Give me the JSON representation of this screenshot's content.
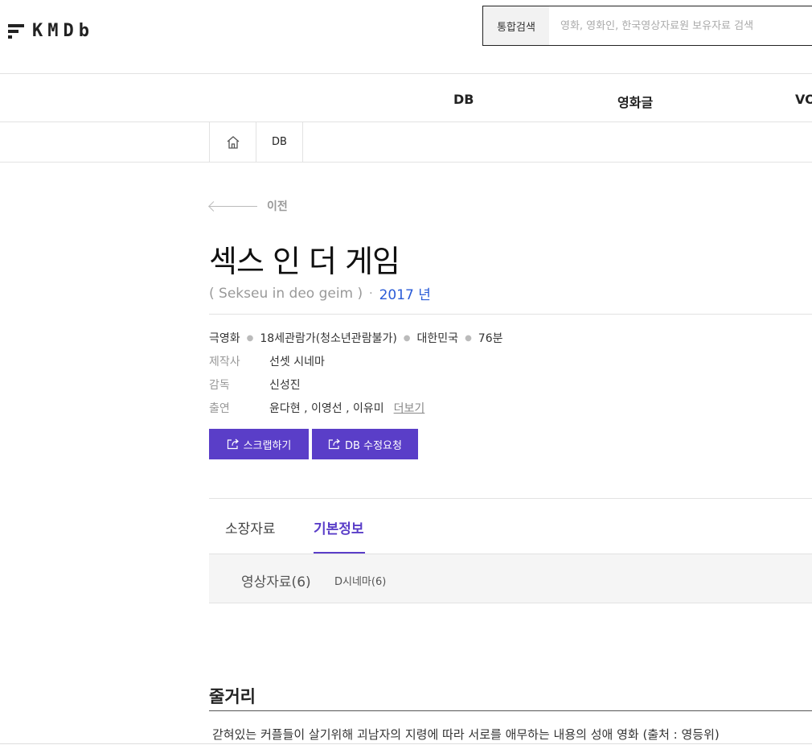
{
  "header": {
    "logo_text": "KMDb",
    "search_category": "통합검색",
    "search_placeholder": "영화, 영화인, 한국영상자료원 보유자료 검색"
  },
  "gnb": {
    "items": [
      "DB",
      "영화글",
      "VO"
    ]
  },
  "breadcrumb": {
    "current": "DB"
  },
  "back_label": "이전",
  "movie": {
    "title": "섹스 인 더 게임",
    "romanized": "( Sekseu in deo geim )",
    "year": "2017 년",
    "genre": "극영화",
    "rating": "18세관람가(청소년관람불가)",
    "country": "대한민국",
    "runtime": "76분",
    "info": [
      {
        "label": "제작사",
        "value": "선셋 시네마"
      },
      {
        "label": "감독",
        "value": "신성진"
      },
      {
        "label": "출연",
        "value": "윤다현 , 이영선 , 이유미"
      }
    ],
    "more_label": "더보기"
  },
  "buttons": {
    "scrap": "스크랩하기",
    "edit_request": "DB 수정요청"
  },
  "tabs": {
    "collection": "소장자료",
    "basic": "기본정보"
  },
  "subtabs": {
    "video": "영상자료(6)",
    "dcinema": "D시네마(6)"
  },
  "synopsis": {
    "title": "줄거리",
    "text": "갇혀있는 커플들이 살기위해 괴남자의 지령에 따라 서로를 애무하는 내용의 성애 영화 (출처 : 영등위)"
  }
}
